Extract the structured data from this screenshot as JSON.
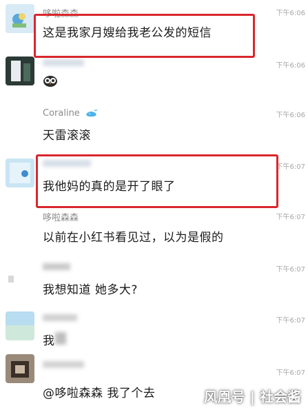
{
  "messages": [
    {
      "sender": "哆啦森森",
      "time": "下午6:06",
      "text": "这是我家月嫂给我老公发的短信"
    },
    {
      "sender": "",
      "time": "下午6:06",
      "text": ""
    },
    {
      "sender": "Coraline",
      "time": "下午6:06",
      "text": "天雷滚滚"
    },
    {
      "sender": "",
      "time": "下午6:07",
      "text": "我他妈的真的是开了眼了"
    },
    {
      "sender": "哆啦森森",
      "time": "下午6:07",
      "text": "以前在小红书看见过，以为是假的"
    },
    {
      "sender": "",
      "time": "下午6:07",
      "text": "我想知道 她多大?"
    },
    {
      "sender": "",
      "time": "下午6:07",
      "text": "我"
    },
    {
      "sender": "",
      "time": "下午6:07",
      "text": "@哆啦森森 我了个去"
    }
  ],
  "icons": {
    "owl_emoji": "owl-emoji-icon",
    "whale_badge": "whale-icon"
  },
  "colors": {
    "highlight": "#d9262c",
    "time_text": "#a6a6a6",
    "sender_text": "#8a8a8a"
  },
  "watermark": "风凰号 | 社会酱"
}
